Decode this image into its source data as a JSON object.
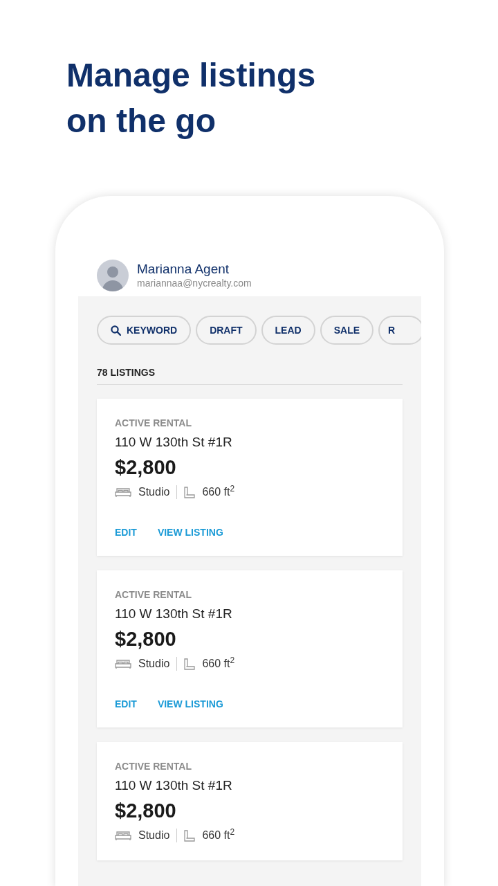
{
  "headline": "Manage listings on the go",
  "user": {
    "name": "Marianna Agent",
    "email": "mariannaa@nycrealty.com"
  },
  "filters": [
    {
      "label": "KEYWORD",
      "kind": "search"
    },
    {
      "label": "DRAFT",
      "kind": "plain"
    },
    {
      "label": "LEAD",
      "kind": "plain"
    },
    {
      "label": "SALE",
      "kind": "plain"
    },
    {
      "label": "R",
      "kind": "plain"
    }
  ],
  "count": "78 LISTINGS",
  "listings": [
    {
      "status": "ACTIVE RENTAL",
      "address": "110 W 130th St #1R",
      "price": "$2,800",
      "beds": "Studio",
      "area": "660 ft$^{2}$",
      "actions": [
        "EDIT",
        "VIEW LISTING"
      ]
    },
    {
      "status": "ACTIVE RENTAL",
      "address": "110 W 130th St #1R",
      "price": "$2,800",
      "beds": "Studio",
      "area": "660 ft$^{2}$",
      "actions": [
        "EDIT",
        "VIEW LISTING"
      ]
    },
    {
      "status": "ACTIVE RENTAL",
      "address": "110 W 130th St #1R",
      "price": "$2,800",
      "beds": "Studio",
      "area": "660 ft$^{2}$"
    }
  ]
}
